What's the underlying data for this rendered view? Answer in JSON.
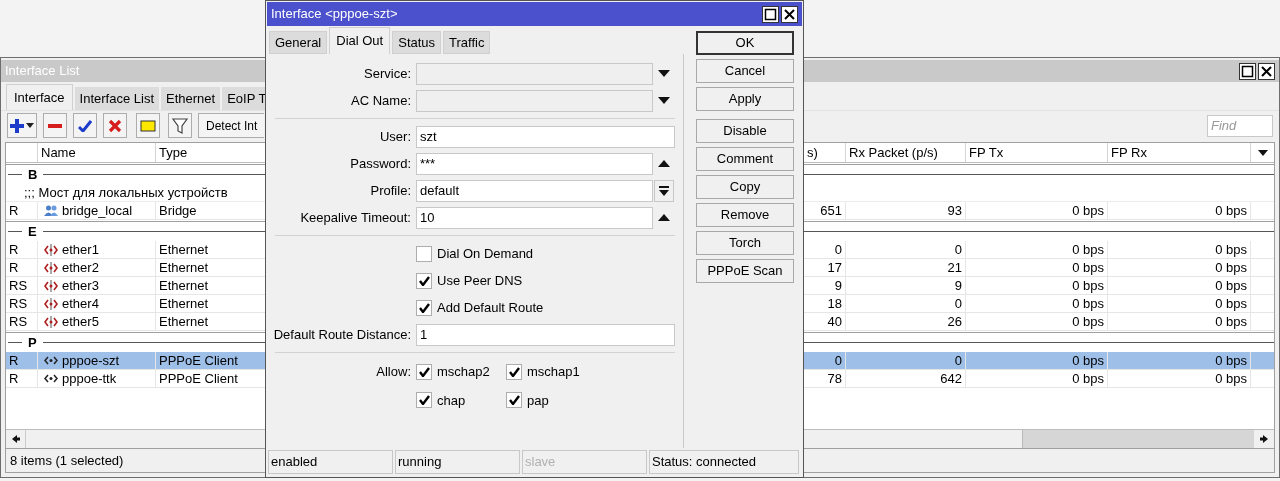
{
  "interface_list": {
    "window": {
      "title": "Interface List"
    },
    "tabs": [
      {
        "label": "Interface",
        "selected": true
      },
      {
        "label": "Interface List",
        "selected": false
      },
      {
        "label": "Ethernet",
        "selected": false
      },
      {
        "label": "EoIP T",
        "selected": false
      }
    ],
    "detect_button": "Detect Int",
    "search": {
      "placeholder": "Find"
    },
    "table": {
      "columns": [
        {},
        {
          "label": "Name"
        },
        {
          "label": "Type"
        },
        {
          "label": "s)"
        },
        {
          "label": "Rx Packet (p/s)"
        },
        {
          "label": "FP Tx"
        },
        {
          "label": "FP Rx"
        }
      ],
      "groups": [
        {
          "label": "B",
          "rows": [
            {
              "comment": ";;; Мост для локальных устройств",
              "flags": "R",
              "kind": "bridge",
              "name": "bridge_local",
              "type": "Bridge",
              "column_4": "651",
              "rx_packet": "93",
              "fp_tx": "0 bps",
              "fp_rx": "0 bps",
              "selected": false
            }
          ]
        },
        {
          "label": "E",
          "rows": [
            {
              "flags": "R",
              "kind": "ethernet",
              "name": "ether1",
              "type": "Ethernet",
              "column_4": "0",
              "rx_packet": "0",
              "fp_tx": "0 bps",
              "fp_rx": "0 bps",
              "selected": false
            },
            {
              "flags": "R",
              "kind": "ethernet",
              "name": "ether2",
              "type": "Ethernet",
              "column_4": "17",
              "rx_packet": "21",
              "fp_tx": "0 bps",
              "fp_rx": "0 bps",
              "selected": false
            },
            {
              "flags": "RS",
              "kind": "ethernet",
              "name": "ether3",
              "type": "Ethernet",
              "column_4": "9",
              "rx_packet": "9",
              "fp_tx": "0 bps",
              "fp_rx": "0 bps",
              "selected": false
            },
            {
              "flags": "RS",
              "kind": "ethernet",
              "name": "ether4",
              "type": "Ethernet",
              "column_4": "18",
              "rx_packet": "0",
              "fp_tx": "0 bps",
              "fp_rx": "0 bps",
              "selected": false
            },
            {
              "flags": "RS",
              "kind": "ethernet",
              "name": "ether5",
              "type": "Ethernet",
              "column_4": "40",
              "rx_packet": "26",
              "fp_tx": "0 bps",
              "fp_rx": "0 bps",
              "selected": false
            }
          ]
        },
        {
          "label": "P",
          "rows": [
            {
              "flags": "R",
              "kind": "pppoe",
              "name": "pppoe-szt",
              "type": "PPPoE Client",
              "column_4": "0",
              "rx_packet": "0",
              "fp_tx": "0 bps",
              "fp_rx": "0 bps",
              "selected": true
            },
            {
              "flags": "R",
              "kind": "pppoe",
              "name": "pppoe-ttk",
              "type": "PPPoE Client",
              "column_4": "78",
              "rx_packet": "642",
              "fp_tx": "0 bps",
              "fp_rx": "0 bps",
              "selected": false
            }
          ]
        }
      ]
    },
    "status_bar": "8 items (1 selected)"
  },
  "dialog": {
    "window": {
      "title": "Interface <pppoe-szt>"
    },
    "tabs": [
      {
        "label": "General",
        "selected": false
      },
      {
        "label": "Dial Out",
        "selected": true
      },
      {
        "label": "Status",
        "selected": false
      },
      {
        "label": "Traffic",
        "selected": false
      }
    ],
    "sections": [
      [
        {
          "kind": "dropdown",
          "label": "Service:"
        },
        {
          "kind": "dropdown",
          "label": "AC Name:"
        }
      ],
      [
        {
          "kind": "text",
          "label": "User:",
          "value": "szt"
        },
        {
          "kind": "expander",
          "label": "Password:",
          "value": "***"
        },
        {
          "kind": "select",
          "label": "Profile:",
          "value": "default"
        },
        {
          "kind": "expander",
          "label": "Keepalive Timeout:",
          "value": "10"
        }
      ],
      [
        {
          "kind": "checkbox",
          "label": "Dial On Demand",
          "checked": false
        },
        {
          "kind": "checkbox",
          "label": "Use Peer DNS",
          "checked": true
        },
        {
          "kind": "checkbox",
          "label": "Add Default Route",
          "checked": true
        },
        {
          "kind": "text",
          "label": "Default Route Distance:",
          "value": "1"
        }
      ],
      [
        {
          "kind": "checks",
          "label": "Allow:",
          "options": [
            {
              "label": "mschap2",
              "checked": true
            },
            {
              "label": "mschap1",
              "checked": true
            },
            {
              "label": "chap",
              "checked": true
            },
            {
              "label": "pap",
              "checked": true
            }
          ]
        }
      ]
    ],
    "button_groups": [
      [
        {
          "label": "OK",
          "default": true
        },
        {
          "label": "Cancel",
          "default": false
        },
        {
          "label": "Apply",
          "default": false
        }
      ],
      [
        {
          "label": "Disable",
          "default": false
        },
        {
          "label": "Comment",
          "default": false
        },
        {
          "label": "Copy",
          "default": false
        },
        {
          "label": "Remove",
          "default": false
        },
        {
          "label": "Torch",
          "default": false
        },
        {
          "label": "PPPoE Scan",
          "default": false
        }
      ]
    ],
    "status_bar": [
      {
        "text": "enabled",
        "disabled": false
      },
      {
        "text": "running",
        "disabled": false
      },
      {
        "text": "slave",
        "disabled": true
      },
      {
        "text": "Status: connected",
        "disabled": false
      }
    ]
  }
}
